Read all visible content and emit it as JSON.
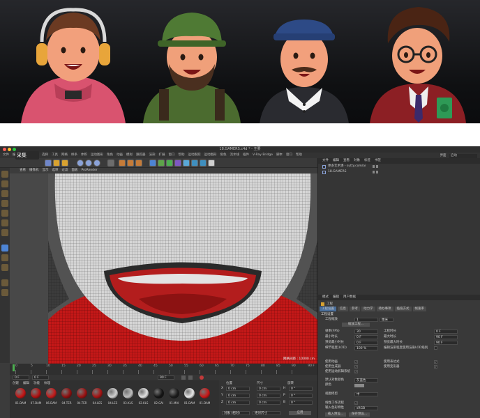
{
  "window": {
    "title": "18.GAMERS.c4d * - 主要",
    "menu": [
      "文件",
      "编辑",
      "创建",
      "模式",
      "选择",
      "工具",
      "网格",
      "样条",
      "体积",
      "运动图形",
      "角色",
      "动画",
      "模拟",
      "跟踪器",
      "渲染",
      "扩展",
      "窗口",
      "帮助",
      "运动跟踪",
      "运动图形",
      "角色",
      "流水线",
      "插件",
      "V-Ray Bridge",
      "脚本",
      "窗口",
      "帮助"
    ],
    "layout_label": "界面",
    "layout_value": "启动"
  },
  "watermark": "采集",
  "viewport": {
    "menu": [
      "查看",
      "摄像机",
      "显示",
      "选项",
      "过滤",
      "面板",
      "ProRender"
    ],
    "camera_label": "透视视图",
    "grid_spacing": "网格间距 : 10000 cm"
  },
  "timeline": {
    "ticks": [
      "0",
      "5",
      "10",
      "15",
      "20",
      "25",
      "30",
      "35",
      "40",
      "45",
      "50",
      "55",
      "60",
      "65",
      "70",
      "75",
      "80",
      "85",
      "90"
    ],
    "end_frame": "90 F",
    "current_frame": "0 F",
    "start_field": "0 F",
    "end_field": "90 F"
  },
  "material_manager": {
    "menu": [
      "创建",
      "编辑",
      "功能",
      "纹理"
    ],
    "materials": [
      {
        "name": "01.DAM",
        "color": "#c41414"
      },
      {
        "name": "07.DAM",
        "color": "#b01010"
      },
      {
        "name": "06.DAM",
        "color": "#c11a1a"
      },
      {
        "name": "04.TER",
        "color": "#8e0e0e"
      },
      {
        "name": "04.TER",
        "color": "#9a1111"
      },
      {
        "name": "04.LES",
        "color": "#a51212"
      },
      {
        "name": "04.LES",
        "color": "#d0d0d0"
      },
      {
        "name": "03.KLS",
        "color": "#bdbdbd"
      },
      {
        "name": "02.KLS",
        "color": "#e2e2e2"
      },
      {
        "name": "02.GAI",
        "color": "#141414"
      },
      {
        "name": "01.MAI",
        "color": "#1a1a1a"
      },
      {
        "name": "01.DAM",
        "color": "#e9e9e9"
      },
      {
        "name": "01.DAM",
        "color": "#c91717"
      }
    ]
  },
  "coordinates": {
    "headers": [
      "位置",
      "尺寸",
      "旋转"
    ],
    "rows": [
      {
        "axis": "X",
        "pos": "0 cm",
        "size": "0 cm",
        "rot_axis": "H",
        "rot": "0 °"
      },
      {
        "axis": "Y",
        "pos": "0 cm",
        "size": "0 cm",
        "rot_axis": "P",
        "rot": "0 °"
      },
      {
        "axis": "Z",
        "pos": "0 cm",
        "size": "0 cm",
        "rot_axis": "B",
        "rot": "0 °"
      }
    ],
    "mode": "对象 (相对)",
    "size_mode": "绝对尺寸",
    "apply": "应用"
  },
  "object_manager": {
    "menu": [
      "文件",
      "编辑",
      "查看",
      "对象",
      "标签",
      "书签"
    ],
    "objects": [
      {
        "name": "更多艺术课 - sutty.com/ai",
        "indent": 0
      },
      {
        "name": "18.GAMERS",
        "indent": 0
      }
    ]
  },
  "attributes": {
    "menu": [
      "模式",
      "编辑",
      "用户数据"
    ],
    "object_label": "工程",
    "tabs": [
      "工程设置",
      "信息",
      "参考",
      "动力学",
      "待办事项",
      "插值方式",
      "帧速率"
    ],
    "section": "工程设置",
    "scale_label": "工程缩放",
    "scale_value": "1",
    "scale_unit": "厘米",
    "scale_button": "缩放工程...",
    "fields": [
      {
        "label": "帧率(FPS)",
        "value": "30",
        "label2": "工程时长",
        "value2": "0 F"
      },
      {
        "label": "最小时长",
        "value": "0 F",
        "label2": "最大时长",
        "value2": "90 F"
      },
      {
        "label": "预览最小时长",
        "value": "0 F",
        "label2": "预览最大时长",
        "value2": "90 F"
      },
      {
        "label": "细节程度(LOD)",
        "value": "100 %",
        "label2": "编辑渲染程度使用渲染LOD级别",
        "value2": ""
      }
    ],
    "checks": [
      {
        "label": "使用动画",
        "checked": true,
        "label2": "使用表达式",
        "checked2": true
      },
      {
        "label": "使用生成器",
        "checked": true,
        "label2": "使用变形器",
        "checked2": true
      },
      {
        "label": "使用运动剪辑系统",
        "checked": true,
        "label2": "",
        "checked2": false
      }
    ],
    "default_color_label": "默认对象颜色",
    "default_color_value": "灰蓝色",
    "color_label": "颜色",
    "view_clip_label": "视图修剪",
    "view_clip_value": "中",
    "linear_label": "线性工作流程",
    "input_color_label": "输入色彩特性",
    "input_color_value": "sRGB",
    "load_button": "载入预设...",
    "save_button": "保存预设..."
  },
  "colors": {
    "accent": "#d8a230",
    "panel": "#3b3b3b",
    "viewport_bg": "#525252",
    "hoodie_red": "#c41818",
    "mouth_red": "#b31d1d"
  }
}
